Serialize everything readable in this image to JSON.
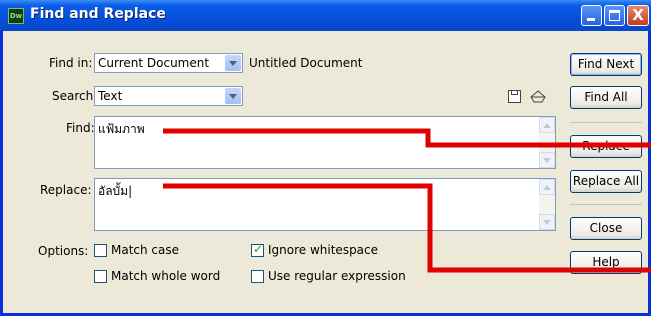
{
  "window": {
    "title": "Find and Replace",
    "app_icon": "Dw",
    "controls": {
      "close_glyph": "X"
    }
  },
  "find_in": {
    "label": "Find in:",
    "selected": "Current Document",
    "document": "Untitled Document"
  },
  "search": {
    "label": "Search:",
    "selected": "Text"
  },
  "find": {
    "label": "Find:",
    "value": "แฟ้มภาพ"
  },
  "replace": {
    "label": "Replace:",
    "value": "อัลบั้ม|"
  },
  "options": {
    "label": "Options:",
    "items": [
      {
        "label": "Match case",
        "checked": false
      },
      {
        "label": "Match whole word",
        "checked": false
      },
      {
        "label": "Ignore whitespace",
        "checked": true
      },
      {
        "label": "Use regular expression",
        "checked": false
      }
    ]
  },
  "buttons": {
    "find_next": "Find Next",
    "find_all": "Find All",
    "replace": "Replace",
    "replace_all": "Replace All",
    "close": "Close",
    "help": "Help"
  },
  "icons": {
    "save": "save-query-icon",
    "open": "load-query-icon"
  },
  "colors": {
    "title_bar": "#0450dd",
    "annotation": "#e00000",
    "window_bg": "#ece9d8"
  }
}
